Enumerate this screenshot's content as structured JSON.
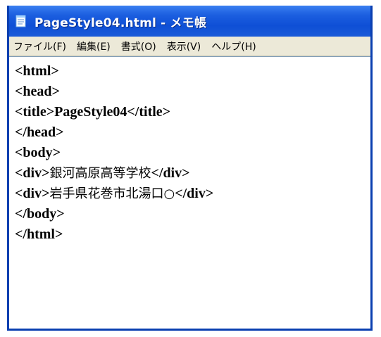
{
  "window": {
    "title": "PageStyle04.html - メモ帳"
  },
  "menu": {
    "items": [
      {
        "label": "ファイル(F)"
      },
      {
        "label": "編集(E)"
      },
      {
        "label": "書式(O)"
      },
      {
        "label": "表示(V)"
      },
      {
        "label": "ヘルプ(H)"
      }
    ]
  },
  "editor": {
    "lines": [
      {
        "text": "<html>"
      },
      {
        "text": "<head>"
      },
      {
        "text": "<title>PageStyle04</title>"
      },
      {
        "text": "</head>"
      },
      {
        "text": "<body>"
      },
      {
        "open": "<div>",
        "content": "銀河高原高等学校",
        "close": "</div>"
      },
      {
        "open": "<div>",
        "content": "岩手県花巻市北湯口○",
        "close": "</div>"
      },
      {
        "text": "</body>"
      },
      {
        "text": "</html>"
      }
    ]
  },
  "colors": {
    "titlebar": "#0e4fd6",
    "menubar": "#ece9d8",
    "frame": "#0a3fb0"
  }
}
